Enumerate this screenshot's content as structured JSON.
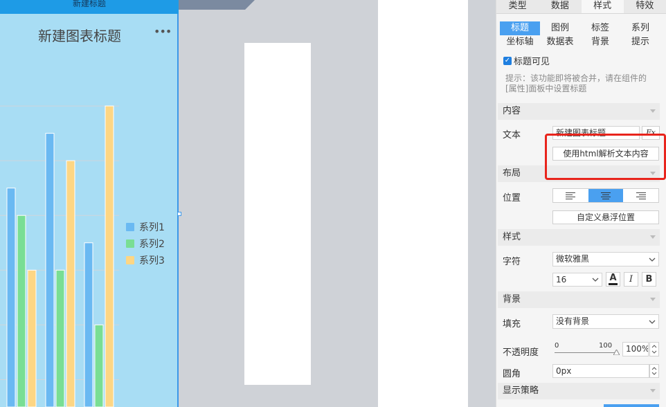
{
  "widget": {
    "topbar_label": "新建标题",
    "title": "新建图表标题",
    "more_label": "•••"
  },
  "chart_data": {
    "type": "bar",
    "title": "新建图表标题",
    "categories": [
      "",
      "",
      ""
    ],
    "series": [
      {
        "name": "系列1",
        "color": "#6ab9f2",
        "values": [
          4.0,
          5.0,
          3.0
        ]
      },
      {
        "name": "系列2",
        "color": "#79de94",
        "values": [
          3.5,
          2.5,
          1.5
        ]
      },
      {
        "name": "系列3",
        "color": "#fdd684",
        "values": [
          2.5,
          4.5,
          5.5
        ]
      }
    ],
    "ylim": [
      0,
      6.5
    ],
    "grid": true,
    "legend_position": "right"
  },
  "panel": {
    "tabs": [
      {
        "label": "类型",
        "active": false
      },
      {
        "label": "数据",
        "active": false
      },
      {
        "label": "样式",
        "active": true
      },
      {
        "label": "特效",
        "active": false
      }
    ],
    "subtabs": [
      {
        "label": "标题",
        "active": true
      },
      {
        "label": "图例",
        "active": false
      },
      {
        "label": "标签",
        "active": false
      },
      {
        "label": "系列",
        "active": false
      },
      {
        "label": "坐标轴",
        "active": false
      },
      {
        "label": "数据表",
        "active": false
      },
      {
        "label": "背景",
        "active": false
      },
      {
        "label": "提示",
        "active": false
      }
    ],
    "title_visible_label": "标题可见",
    "title_visible": true,
    "hint_line1": "提示：该功能即将被合并，请在组件的",
    "hint_line2": "[属性]面板中设置标题",
    "sections": {
      "content": "内容",
      "layout": "布局",
      "style": "样式",
      "background": "背景",
      "display_strategy": "显示策略"
    },
    "text_label": "文本",
    "text_value": "新建图表标题",
    "formula_label": "Fx",
    "html_button": "使用html解析文本内容",
    "position_label": "位置",
    "custom_float_button": "自定义悬浮位置",
    "font_label": "字符",
    "font_value": "微软雅黑",
    "font_size": "16",
    "bold_label": "B",
    "italic_label": "I",
    "color_label": "A",
    "fill_label": "填充",
    "fill_value": "没有背景",
    "opacity_label": "不透明度",
    "opacity_min": "0",
    "opacity_max": "100",
    "opacity_value": "100%",
    "radius_label": "圆角",
    "radius_value": "0px"
  },
  "colors": {
    "accent": "#4aa0f0",
    "highlight_box": "#e8241c"
  }
}
